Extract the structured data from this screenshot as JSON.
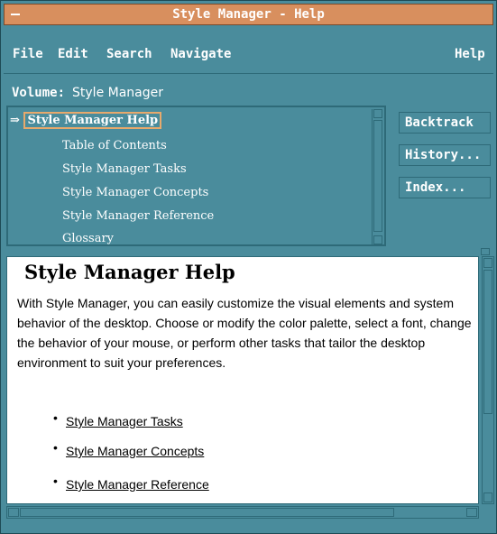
{
  "window": {
    "title": "Style Manager - Help"
  },
  "menubar": {
    "file": "File",
    "edit": "Edit",
    "search": "Search",
    "navigate": "Navigate",
    "help": "Help"
  },
  "volume": {
    "label": "Volume:",
    "value": "Style Manager"
  },
  "toc": {
    "current": "Style Manager Help",
    "items": [
      "Table of Contents",
      "Style Manager Tasks",
      "Style Manager Concepts",
      "Style Manager Reference",
      "Glossary"
    ]
  },
  "buttons": {
    "backtrack": "Backtrack",
    "history": "History...",
    "index": "Index..."
  },
  "content": {
    "title": "Style Manager Help",
    "paragraph": "With Style Manager, you can easily customize the visual elements and system behavior of the desktop. Choose or modify the color palette, select a font, change the behavior of your mouse, or perform other tasks that tailor the desktop environment to suit your preferences.",
    "links": [
      "Style Manager Tasks",
      "Style Manager Concepts",
      "Style Manager Reference"
    ]
  },
  "colors": {
    "window_bg": "#4a8c9c",
    "titlebar": "#d88f5e",
    "highlight": "#e7a96c",
    "pane": "#ffffff"
  },
  "icons": [
    "window-menu-icon",
    "arrow-right-icon",
    "scroll-up-icon",
    "scroll-down-icon",
    "scroll-left-icon",
    "scroll-right-icon",
    "bullet-icon"
  ]
}
